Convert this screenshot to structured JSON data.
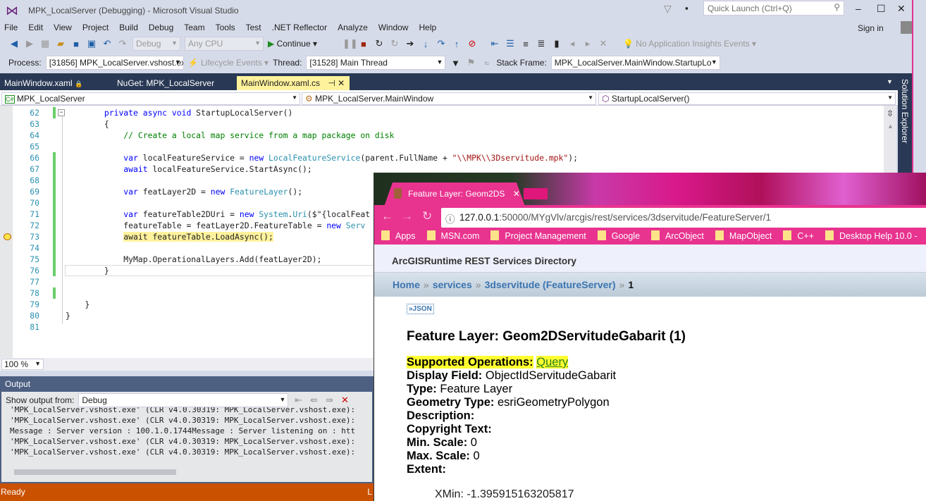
{
  "window": {
    "title": "MPK_LocalServer (Debugging) - Microsoft Visual Studio",
    "quick_launch_placeholder": "Quick Launch (Ctrl+Q)",
    "sign_in": "Sign in"
  },
  "menu": [
    "File",
    "Edit",
    "View",
    "Project",
    "Build",
    "Debug",
    "Team",
    "Tools",
    "Test",
    ".NET Reflector",
    "Analyze",
    "Window",
    "Help"
  ],
  "toolbar": {
    "config": "Debug",
    "platform": "Any CPU",
    "continue": "Continue",
    "insights": "No Application Insights Events"
  },
  "debug_toolbar": {
    "process_label": "Process:",
    "process": "[31856] MPK_LocalServer.vshost.ex",
    "lifecycle": "Lifecycle Events",
    "thread_label": "Thread:",
    "thread": "[31528] Main Thread",
    "stack_label": "Stack Frame:",
    "stack": "MPK_LocalServer.MainWindow.StartupLo"
  },
  "tabs": [
    {
      "label": "MainWindow.xaml"
    },
    {
      "label": "NuGet: MPK_LocalServer"
    },
    {
      "label": "MainWindow.xaml.cs",
      "active": true
    }
  ],
  "nav": {
    "project": "MPK_LocalServer",
    "class": "MPK_LocalServer.MainWindow",
    "member": "StartupLocalServer()"
  },
  "code": [
    {
      "n": "62",
      "chg": true,
      "t": [
        [
          "        ",
          ""
        ],
        [
          "private async void",
          "kw"
        ],
        [
          " StartupLocalServer()",
          ""
        ]
      ]
    },
    {
      "n": "63",
      "t": [
        [
          "        {",
          ""
        ]
      ]
    },
    {
      "n": "64",
      "t": [
        [
          "            // Create a local map service from a map package on disk",
          "cm"
        ]
      ]
    },
    {
      "n": "65",
      "t": []
    },
    {
      "n": "66",
      "chg": true,
      "t": [
        [
          "            ",
          ""
        ],
        [
          "var",
          "kw"
        ],
        [
          " localFeatureService = ",
          ""
        ],
        [
          "new",
          "kw"
        ],
        [
          " ",
          ""
        ],
        [
          "LocalFeatureService",
          "ty"
        ],
        [
          "(parent.FullName + ",
          ""
        ],
        [
          "\"\\\\MPK\\\\3Dservitude.mpk\"",
          "st"
        ],
        [
          ");",
          ""
        ]
      ]
    },
    {
      "n": "67",
      "chg": true,
      "t": [
        [
          "            ",
          ""
        ],
        [
          "await",
          "kw"
        ],
        [
          " localFeatureService.StartAsync();",
          ""
        ]
      ]
    },
    {
      "n": "68",
      "chg": true,
      "t": []
    },
    {
      "n": "69",
      "chg": true,
      "t": [
        [
          "            ",
          ""
        ],
        [
          "var",
          "kw"
        ],
        [
          " featLayer2D = ",
          ""
        ],
        [
          "new",
          "kw"
        ],
        [
          " ",
          ""
        ],
        [
          "FeatureLayer",
          "ty"
        ],
        [
          "();",
          ""
        ]
      ]
    },
    {
      "n": "70",
      "chg": true,
      "t": []
    },
    {
      "n": "71",
      "chg": true,
      "t": [
        [
          "            ",
          ""
        ],
        [
          "var",
          "kw"
        ],
        [
          " featureTable2DUri = ",
          ""
        ],
        [
          "new",
          "kw"
        ],
        [
          " ",
          ""
        ],
        [
          "System",
          "ty"
        ],
        [
          ".",
          ""
        ],
        [
          "Uri",
          "ty"
        ],
        [
          "($\"{localFeat",
          ""
        ]
      ]
    },
    {
      "n": "72",
      "chg": true,
      "t": [
        [
          "            featureTable = featLayer2D.FeatureTable = ",
          ""
        ],
        [
          "new",
          "kw"
        ],
        [
          " ",
          ""
        ],
        [
          "Serv",
          "ty"
        ]
      ]
    },
    {
      "n": "73",
      "chg": true,
      "bp": true,
      "t": [
        [
          "            ",
          ""
        ],
        [
          "await featureTable.LoadAsync();",
          "hl"
        ]
      ]
    },
    {
      "n": "74",
      "chg": true,
      "t": []
    },
    {
      "n": "75",
      "chg": true,
      "t": [
        [
          "            MyMap.OperationalLayers.Add(featLayer2D);",
          ""
        ]
      ]
    },
    {
      "n": "76",
      "chg": true,
      "cur": true,
      "t": [
        [
          "        }",
          ""
        ]
      ]
    },
    {
      "n": "77",
      "t": []
    },
    {
      "n": "78",
      "chg": true,
      "t": []
    },
    {
      "n": "79",
      "t": [
        [
          "    }",
          ""
        ]
      ]
    },
    {
      "n": "80",
      "t": [
        [
          "}",
          ""
        ]
      ]
    },
    {
      "n": "81",
      "t": []
    }
  ],
  "zoom": "100 %",
  "output": {
    "title": "Output",
    "show_from_label": "Show output from:",
    "source": "Debug",
    "lines": [
      "'MPK_LocalServer.vshost.exe' (CLR v4.0.30319: MPK_LocalServer.vshost.exe):",
      "'MPK_LocalServer.vshost.exe' (CLR v4.0.30319: MPK_LocalServer.vshost.exe):",
      "Message : Server version : 100.1.0.1744Message : Server listening on : htt",
      "'MPK_LocalServer.vshost.exe' (CLR v4.0.30319: MPK_LocalServer.vshost.exe):",
      "'MPK_LocalServer.vshost.exe' (CLR v4.0.30319: MPK_LocalServer.vshost.exe):"
    ]
  },
  "status": {
    "text": "Ready",
    "right": "L"
  },
  "solution_explorer": "Solution Explorer",
  "browser": {
    "tab": "Feature Layer: Geom2DS",
    "url_host": "127.0.0.1",
    "url_rest": ":50000/MYgVlv/arcgis/rest/services/3dservitude/FeatureServer/1",
    "bookmarks": [
      "Apps",
      "MSN.com",
      "Project Management",
      "Google",
      "ArcObject",
      "MapObject",
      "C++",
      "Desktop Help 10.0 - "
    ],
    "header": "ArcGISRuntime REST Services Directory",
    "breadcrumb": [
      "Home",
      "services",
      "3dservitude (FeatureServer)",
      "1"
    ],
    "crumb_sep": "»",
    "json_link": "»JSON",
    "title": "Feature Layer: Geom2DServitudeGabarit (1)",
    "props": [
      {
        "k": "Supported Operations:",
        "v": "Query",
        "link": true
      },
      {
        "k": "Display Field:",
        "v": "ObjectIdServitudeGabarit"
      },
      {
        "k": "Type:",
        "v": "Feature Layer"
      },
      {
        "k": "Geometry Type:",
        "v": "esriGeometryPolygon"
      },
      {
        "k": "Description:",
        "v": ""
      },
      {
        "k": "Copyright Text:",
        "v": ""
      },
      {
        "k": "Min. Scale:",
        "v": "0"
      },
      {
        "k": "Max. Scale:",
        "v": "0"
      },
      {
        "k": "Extent:",
        "v": ""
      }
    ],
    "xmin": "XMin: -1.395915163205817"
  },
  "colors": {
    "vs_bg": "#d6dbe9",
    "tab_active": "#fff29d",
    "status": "#ca5100",
    "browser_accent": "#e8338f",
    "link": "#3b75b0",
    "highlight": "#ffff30"
  }
}
